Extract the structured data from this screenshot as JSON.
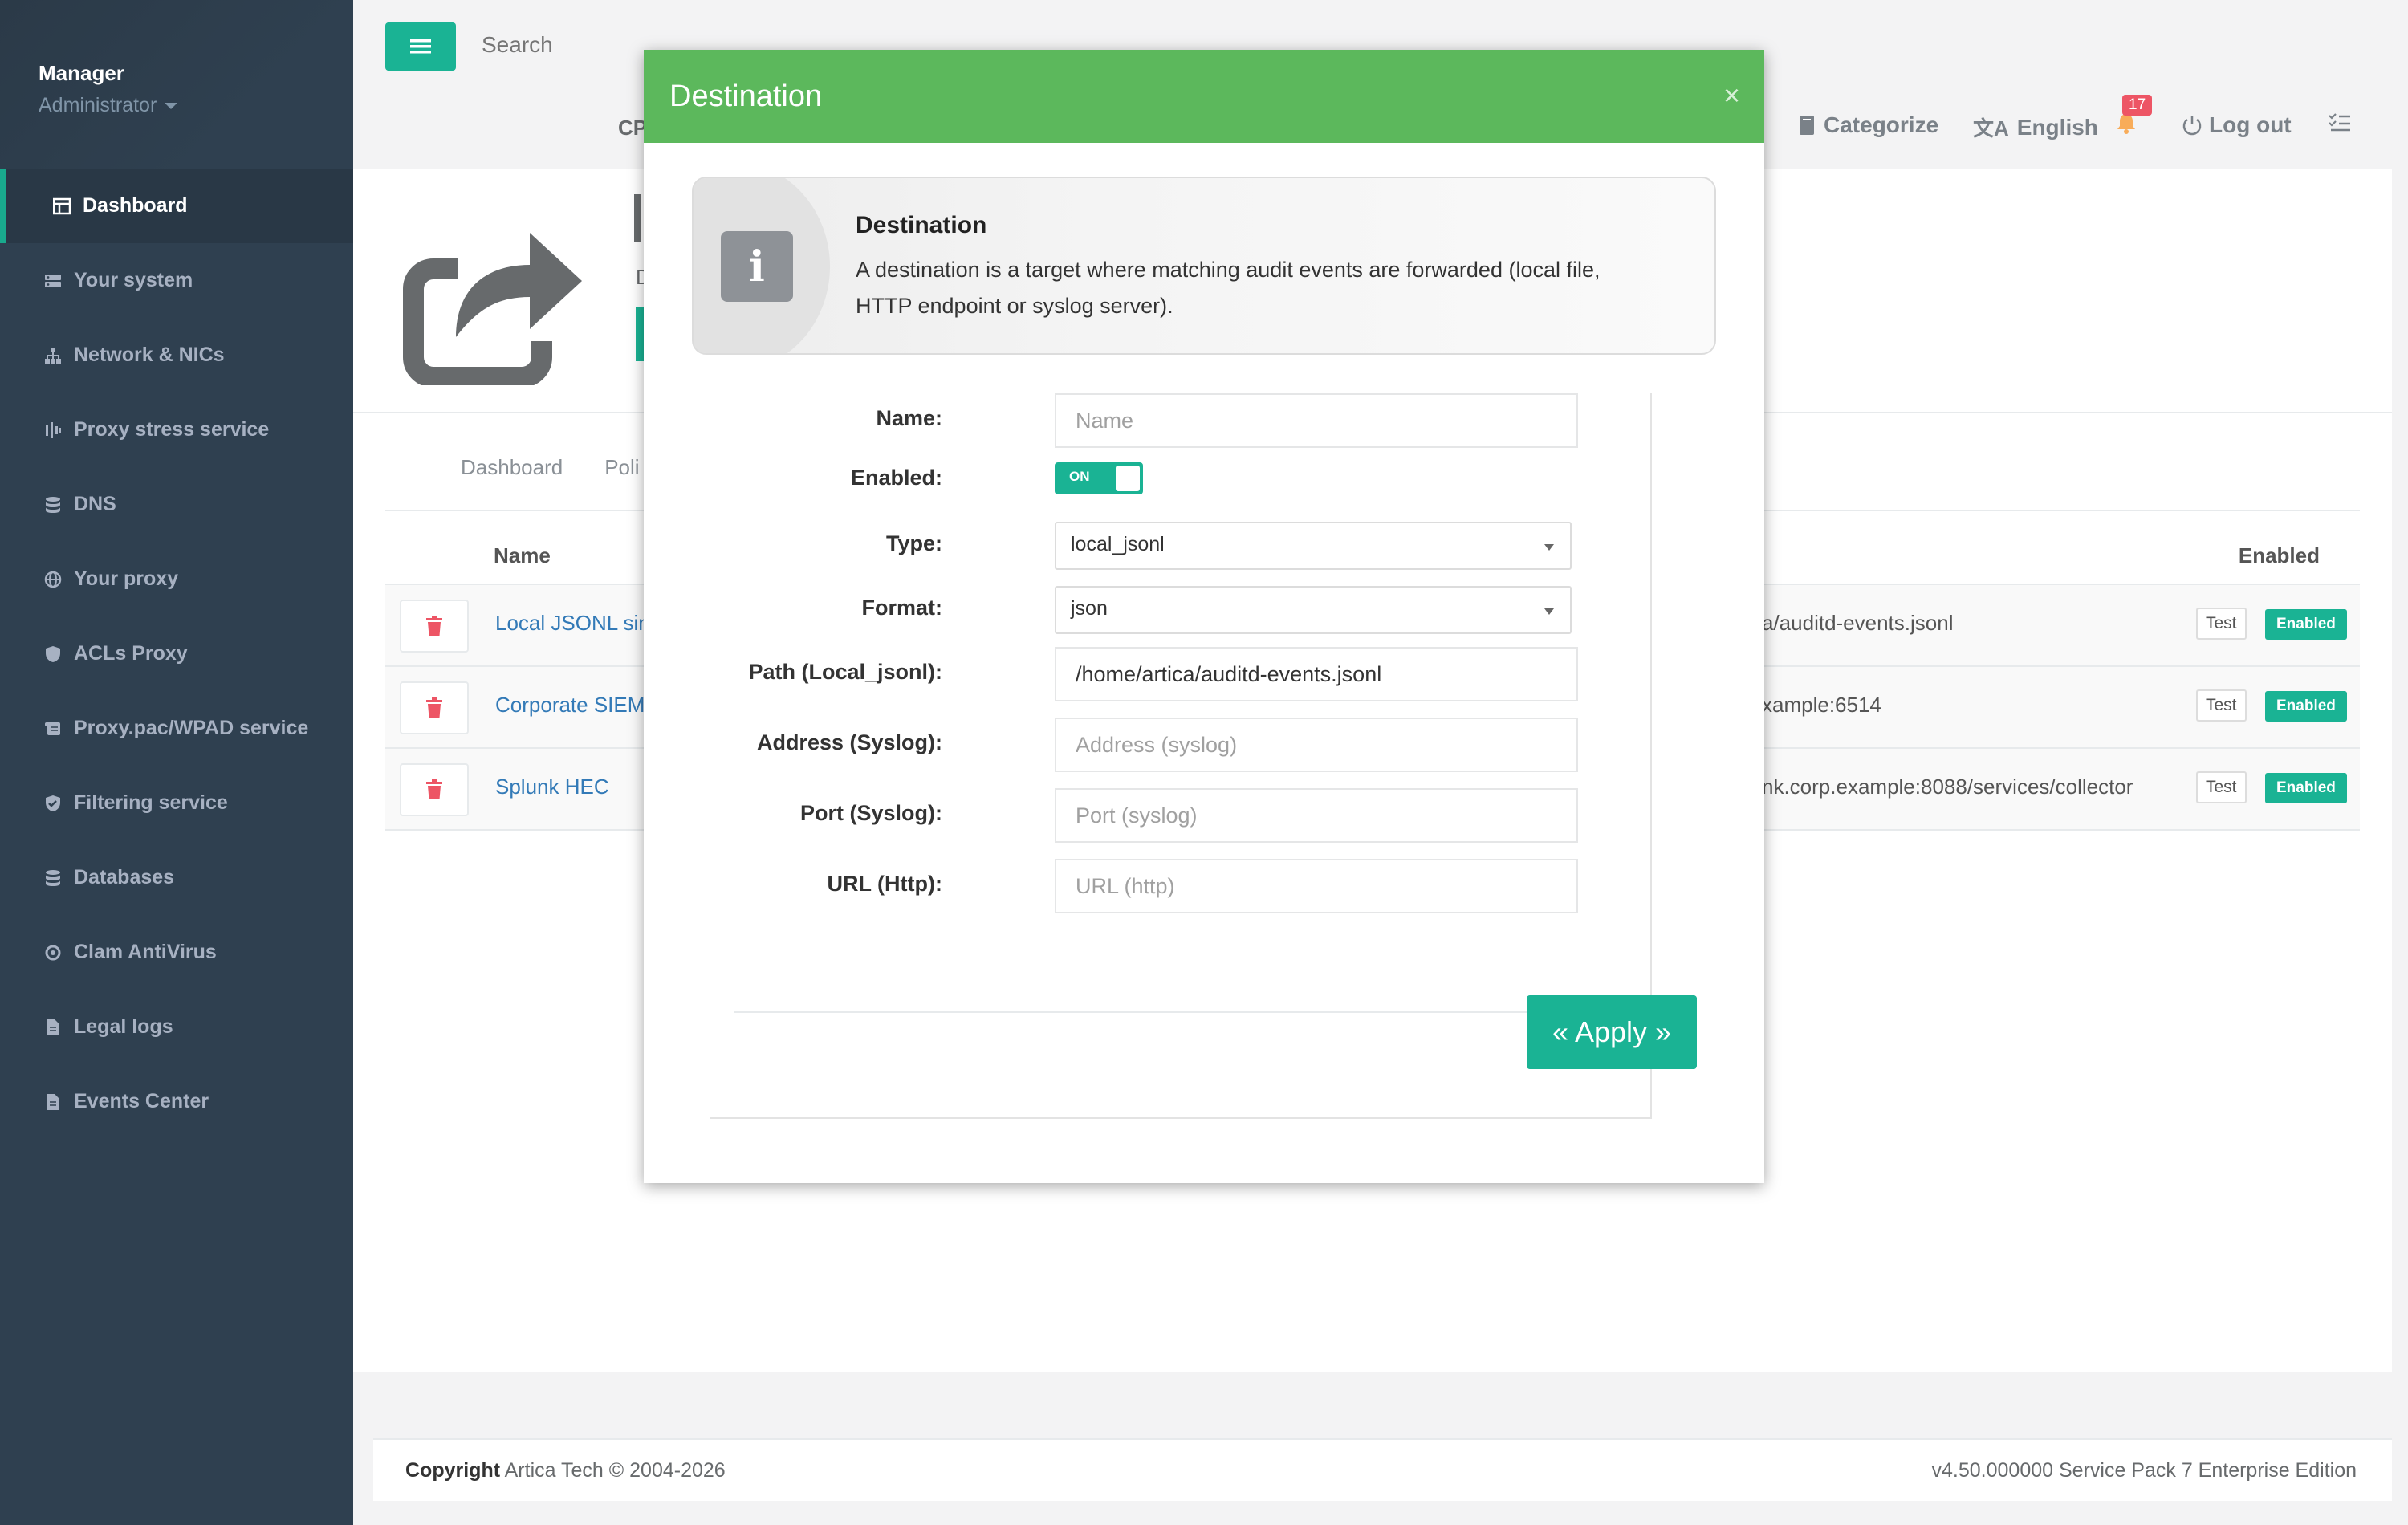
{
  "profile": {
    "name": "Manager",
    "role": "Administrator"
  },
  "sidebar": {
    "items": [
      {
        "label": "Dashboard",
        "icon": "dashboard-icon"
      },
      {
        "label": "Your system",
        "icon": "server-icon"
      },
      {
        "label": "Network & NICs",
        "icon": "sitemap-icon"
      },
      {
        "label": "Proxy stress service",
        "icon": "stress-icon"
      },
      {
        "label": "DNS",
        "icon": "database-icon"
      },
      {
        "label": "Your proxy",
        "icon": "globe-icon"
      },
      {
        "label": "ACLs Proxy",
        "icon": "shield-icon"
      },
      {
        "label": "Proxy.pac/WPAD service",
        "icon": "script-icon"
      },
      {
        "label": "Filtering service",
        "icon": "shield-check-icon"
      },
      {
        "label": "Databases",
        "icon": "database-icon"
      },
      {
        "label": "Clam AntiVirus",
        "icon": "virus-icon"
      },
      {
        "label": "Legal logs",
        "icon": "file-icon"
      },
      {
        "label": "Events Center",
        "icon": "file-icon"
      }
    ]
  },
  "topbar": {
    "search_placeholder": "Search",
    "cpu_label": "CP",
    "categorize": "Categorize",
    "language": "English",
    "notifications_count": "17",
    "logout": "Log out"
  },
  "header": {
    "fragment": "D"
  },
  "content": {
    "tabs": [
      "Dashboard",
      "Poli"
    ],
    "columns": {
      "name": "Name",
      "enabled": "Enabled"
    },
    "rows": [
      {
        "name": "Local JSONL sink",
        "path": "a/auditd-events.jsonl",
        "test": "Test",
        "status": "Enabled"
      },
      {
        "name": "Corporate SIEM",
        "path": "xample:6514",
        "test": "Test",
        "status": "Enabled"
      },
      {
        "name": "Splunk HEC",
        "path": "nk.corp.example:8088/services/collector",
        "test": "Test",
        "status": "Enabled"
      }
    ]
  },
  "footer": {
    "copyright_bold": "Copyright",
    "copyright_text": "Artica Tech © 2004-2026",
    "version": "v4.50.000000 Service Pack 7 Enterprise Edition"
  },
  "modal": {
    "title": "Destination",
    "close": "×",
    "info_title": "Destination",
    "info_text": "A destination is a target where matching audit events are forwarded (local file, HTTP endpoint or syslog server).",
    "fields": {
      "name": {
        "label": "Name:",
        "placeholder": "Name",
        "value": ""
      },
      "enabled": {
        "label": "Enabled:",
        "state": "ON"
      },
      "type": {
        "label": "Type:",
        "value": "local_jsonl"
      },
      "format": {
        "label": "Format:",
        "value": "json"
      },
      "path": {
        "label": "Path (Local_jsonl):",
        "value": "/home/artica/auditd-events.jsonl"
      },
      "address": {
        "label": "Address (Syslog):",
        "placeholder": "Address (syslog)",
        "value": ""
      },
      "port": {
        "label": "Port (Syslog):",
        "placeholder": "Port (syslog)",
        "value": ""
      },
      "url": {
        "label": "URL (Http):",
        "placeholder": "URL (http)",
        "value": ""
      }
    },
    "apply": "« Apply »"
  },
  "colors": {
    "sidebar": "#2f4050",
    "accent": "#1ab394",
    "modal_header": "#5cb85c",
    "danger": "#ed5565"
  }
}
